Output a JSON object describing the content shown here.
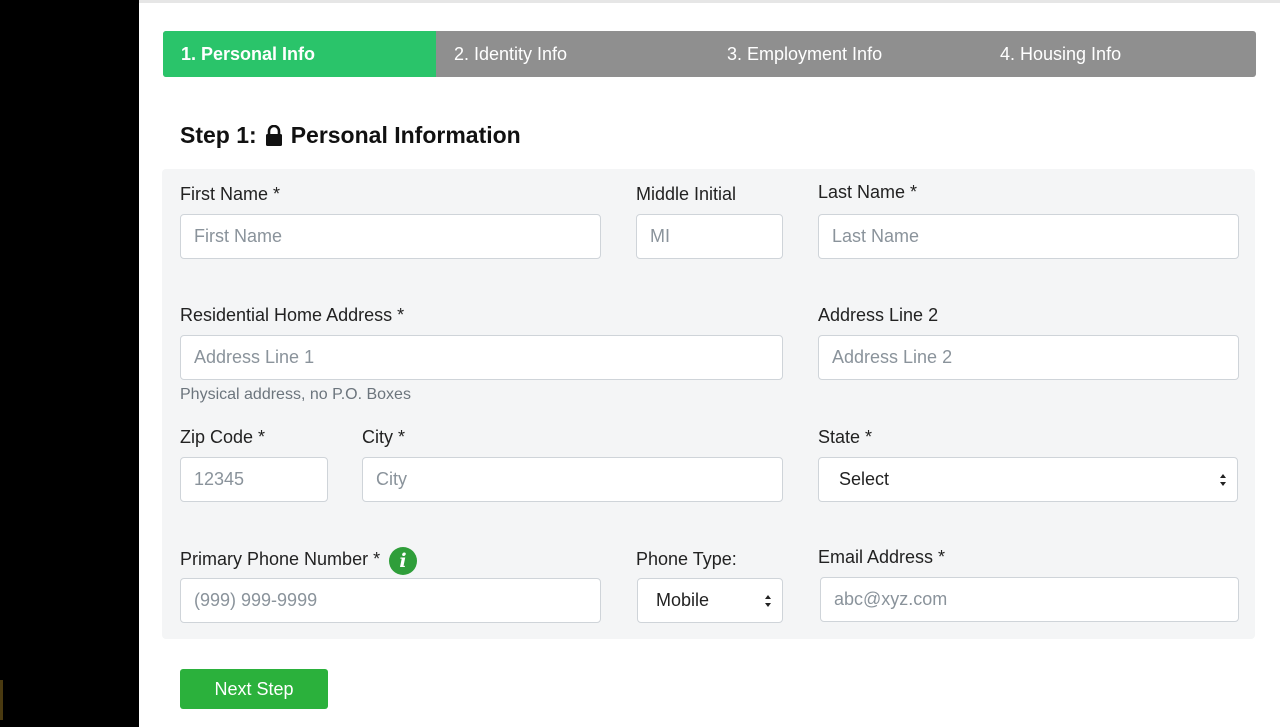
{
  "steps": [
    {
      "label": "1. Personal Info",
      "active": true
    },
    {
      "label": "2. Identity Info",
      "active": false
    },
    {
      "label": "3. Employment Info",
      "active": false
    },
    {
      "label": "4. Housing Info",
      "active": false
    }
  ],
  "heading": {
    "prefix": "Step 1:",
    "title": "Personal Information",
    "icon": "lock-icon"
  },
  "form": {
    "first_name": {
      "label": "First Name *",
      "placeholder": "First Name",
      "value": ""
    },
    "middle_initial": {
      "label": "Middle Initial",
      "placeholder": "MI",
      "value": ""
    },
    "last_name": {
      "label": "Last Name *",
      "placeholder": "Last Name",
      "value": ""
    },
    "address1": {
      "label": "Residential Home Address *",
      "placeholder": "Address Line 1",
      "value": "",
      "help": "Physical address, no P.O. Boxes"
    },
    "address2": {
      "label": "Address Line 2",
      "placeholder": "Address Line 2",
      "value": ""
    },
    "zip": {
      "label": "Zip Code *",
      "placeholder": "12345",
      "value": ""
    },
    "city": {
      "label": "City *",
      "placeholder": "City",
      "value": ""
    },
    "state": {
      "label": "State *",
      "selected": "Select"
    },
    "phone": {
      "label": "Primary Phone Number *",
      "placeholder": "(999) 999-9999",
      "value": "",
      "info_icon": "info-icon"
    },
    "phone_type": {
      "label": "Phone Type:",
      "selected": "Mobile"
    },
    "email": {
      "label": "Email Address *",
      "placeholder": "abc@xyz.com",
      "value": ""
    }
  },
  "next_button": {
    "label": "Next Step"
  },
  "colors": {
    "active_step": "#2ac46a",
    "inactive_step": "#8f8f8f",
    "button": "#2bb13c",
    "panel": "#f4f5f6"
  }
}
